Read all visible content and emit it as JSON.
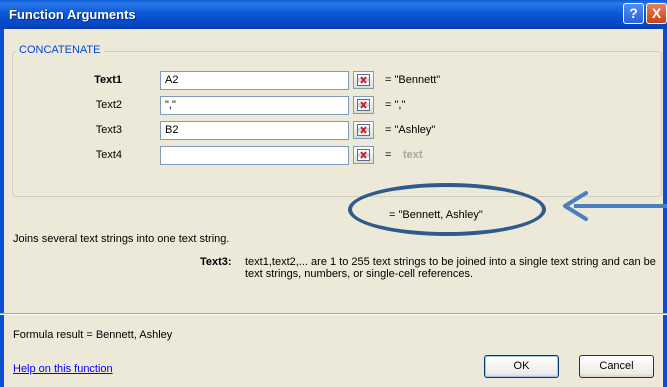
{
  "window": {
    "title": "Function Arguments",
    "help_glyph": "?",
    "close_glyph": "X"
  },
  "function_name": "CONCATENATE",
  "arguments": [
    {
      "label": "Text1",
      "input": "A2",
      "value": "= \"Bennett\""
    },
    {
      "label": "Text2",
      "input": "\",\"",
      "value": "= \",\""
    },
    {
      "label": "Text3",
      "input": "B2",
      "value": "= \"Ashley\""
    },
    {
      "label": "Text4",
      "input": "",
      "value": "=",
      "value_hint": "text"
    }
  ],
  "result": "= \"Bennett, Ashley\"",
  "description": "Joins several text strings into one text string.",
  "detail": {
    "label": "Text3:",
    "text": "text1,text2,... are 1 to 255 text strings to be joined into a single text string and can be text strings, numbers, or single-cell references."
  },
  "formula_result": "Formula result =  Bennett, Ashley",
  "help_link": "Help on this function",
  "buttons": {
    "ok": "OK",
    "cancel": "Cancel"
  },
  "annotation": {
    "ellipse_color": "#2f5b8c",
    "arrow_color": "#4a7fbf"
  }
}
